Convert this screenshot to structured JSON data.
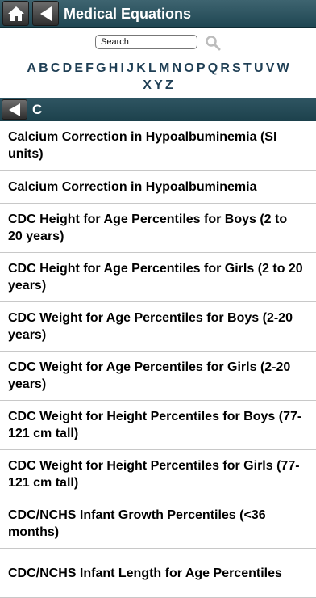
{
  "header": {
    "title": "Medical Equations",
    "home_icon": "home-icon",
    "back_icon": "back-arrow-icon"
  },
  "search": {
    "placeholder": "Search",
    "icon": "search-icon"
  },
  "alphabet": [
    "A",
    "B",
    "C",
    "D",
    "E",
    "F",
    "G",
    "H",
    "I",
    "J",
    "K",
    "L",
    "M",
    "N",
    "O",
    "P",
    "Q",
    "R",
    "S",
    "T",
    "U",
    "V",
    "W",
    "X",
    "Y",
    "Z"
  ],
  "section": {
    "letter": "C"
  },
  "items": [
    "Calcium Correction in Hypoalbuminemia (SI units)",
    "Calcium Correction in Hypoalbuminemia",
    "CDC Height for Age Percentiles for Boys (2 to 20 years)",
    "CDC Height for Age Percentiles for Girls (2 to 20 years)",
    "CDC Weight for Age Percentiles for Boys (2-20 years)",
    "CDC Weight for Age Percentiles for Girls (2-20 years)",
    "CDC Weight for Height Percentiles for Boys (77-121 cm tall)",
    "CDC Weight for Height Percentiles for Girls (77-121 cm tall)",
    "CDC/NCHS Infant Growth Percentiles (<36 months)",
    "CDC/NCHS Infant Length for Age Percentiles"
  ],
  "colors": {
    "header_bar": "#2d5360",
    "alphabet_text": "#1f3f55",
    "button": "#4a4a4a"
  }
}
